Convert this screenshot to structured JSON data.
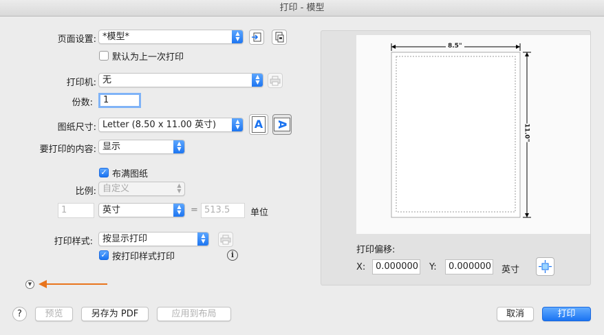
{
  "window": {
    "title": "打印 - 模型"
  },
  "page_setup": {
    "label": "页面设置:",
    "value": "*模型*",
    "default_checkbox_label": "默认为上一次打印",
    "default_checked": false
  },
  "printer": {
    "label": "打印机:",
    "value": "无"
  },
  "copies": {
    "label": "份数:",
    "value": "1"
  },
  "paper_size": {
    "label": "图纸尺寸:",
    "value": "Letter (8.50 x 11.00 英寸)",
    "portrait_glyph": "A",
    "landscape_glyph": "A"
  },
  "print_what": {
    "label": "要打印的内容:",
    "value": "显示"
  },
  "fit_to_paper": {
    "label": "布满图纸",
    "checked": true
  },
  "scale": {
    "label": "比例:",
    "value": "自定义",
    "left_value": "1",
    "unit_value": "英寸",
    "equals": "=",
    "right_value": "513.5",
    "right_unit": "单位"
  },
  "plot_style": {
    "label": "打印样式:",
    "value": "按显示打印",
    "print_with_styles_label": "按打印样式打印",
    "print_with_styles_checked": true,
    "info_glyph": "i"
  },
  "preview": {
    "width_label": "8.5\"",
    "height_label": "11.0\""
  },
  "offset": {
    "label": "打印偏移:",
    "x_label": "X:",
    "x_value": "0.000000",
    "y_label": "Y:",
    "y_value": "0.000000",
    "unit": "英寸"
  },
  "footer": {
    "help": "?",
    "preview_btn": "预览",
    "save_pdf_btn": "另存为 PDF",
    "apply_layout_btn": "应用到布局",
    "cancel_btn": "取消",
    "print_btn": "打印"
  },
  "colors": {
    "accent": "#1a73f0",
    "arrow": "#e8741c"
  }
}
